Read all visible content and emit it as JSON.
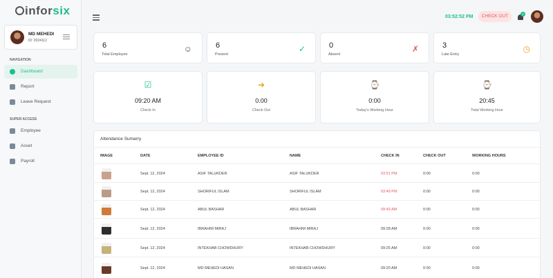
{
  "brand": {
    "part1": "infor",
    "part2": "six"
  },
  "user": {
    "name": "MD MEHEDI",
    "id": "ID: 2024112"
  },
  "nav": {
    "section1": "NAVIGATION",
    "section2": "SUPER ACCESS",
    "items": [
      {
        "label": "Dashboard"
      },
      {
        "label": "Report"
      },
      {
        "label": "Leave Request"
      },
      {
        "label": "Employee"
      },
      {
        "label": "Asset"
      },
      {
        "label": "Payroll"
      }
    ]
  },
  "topbar": {
    "time": "03:52:52 PM",
    "checkout": "CHECK OUT",
    "notif_count": "2"
  },
  "stats": [
    {
      "value": "6",
      "label": "Total Employee",
      "icon": "users-icon",
      "color": "#555555"
    },
    {
      "value": "6",
      "label": "Present",
      "icon": "user-check-icon",
      "color": "#1cbf8c"
    },
    {
      "value": "0",
      "label": "Absent",
      "icon": "user-x-icon",
      "color": "#e05a5a"
    },
    {
      "value": "3",
      "label": "Late Entry",
      "icon": "user-clock-icon",
      "color": "#f0a020"
    }
  ],
  "times": [
    {
      "value": "09:20 AM",
      "label": "Check In",
      "icon": "check-square-icon",
      "color": "#1cbf8c"
    },
    {
      "value": "0.00",
      "label": "Check Out",
      "icon": "exit-icon",
      "color": "#f0a020"
    },
    {
      "value": "0:00",
      "label": "Today's Working Hour",
      "icon": "watch-icon",
      "color": "#1cbf8c"
    },
    {
      "value": "20:45",
      "label": "Total Working Hour",
      "icon": "watch-icon",
      "color": "#1cbf8c"
    }
  ],
  "attendance": {
    "title": "Attendance Sumarry",
    "headers": [
      "IMAGE",
      "DATE",
      "EMPLOYEE ID",
      "NAME",
      "CHECK IN",
      "CHECK OUT",
      "WORKING HOURS"
    ],
    "rows": [
      {
        "date": "Sept. 12, 2024",
        "emp_id": "ASIF TALUKDER",
        "name": "ASIF TALUKDER",
        "check_in": "03:51 PM",
        "late": true,
        "check_out": "0:00",
        "hours": "0:00"
      },
      {
        "date": "Sept. 12, 2024",
        "emp_id": "SHORIFUL ISLAM",
        "name": "SHORIFUL ISLAM",
        "check_in": "03:49 PM",
        "late": true,
        "check_out": "0:00",
        "hours": "0:00"
      },
      {
        "date": "Sept. 12, 2024",
        "emp_id": "ABUL BASHAR",
        "name": "ABUL BASHAR",
        "check_in": "09:49 AM",
        "late": true,
        "check_out": "0:00",
        "hours": "0:00"
      },
      {
        "date": "Sept. 12, 2024",
        "emp_id": "IBRAHIM MIRAJ",
        "name": "IBRAHIM MIRAJ",
        "check_in": "09:28 AM",
        "late": false,
        "check_out": "0:00",
        "hours": "0:00"
      },
      {
        "date": "Sept. 12, 2024",
        "emp_id": "INTEKHAB CHOWDHURY",
        "name": "INTEKHAB CHOWDHURY",
        "check_in": "09:25 AM",
        "late": false,
        "check_out": "0:00",
        "hours": "0:00"
      },
      {
        "date": "Sept. 12, 2024",
        "emp_id": "MD MEHEDI HASAN",
        "name": "MD MEHEDI HASAN",
        "check_in": "09:20 AM",
        "late": false,
        "check_out": "0:00",
        "hours": "0:00"
      }
    ]
  }
}
